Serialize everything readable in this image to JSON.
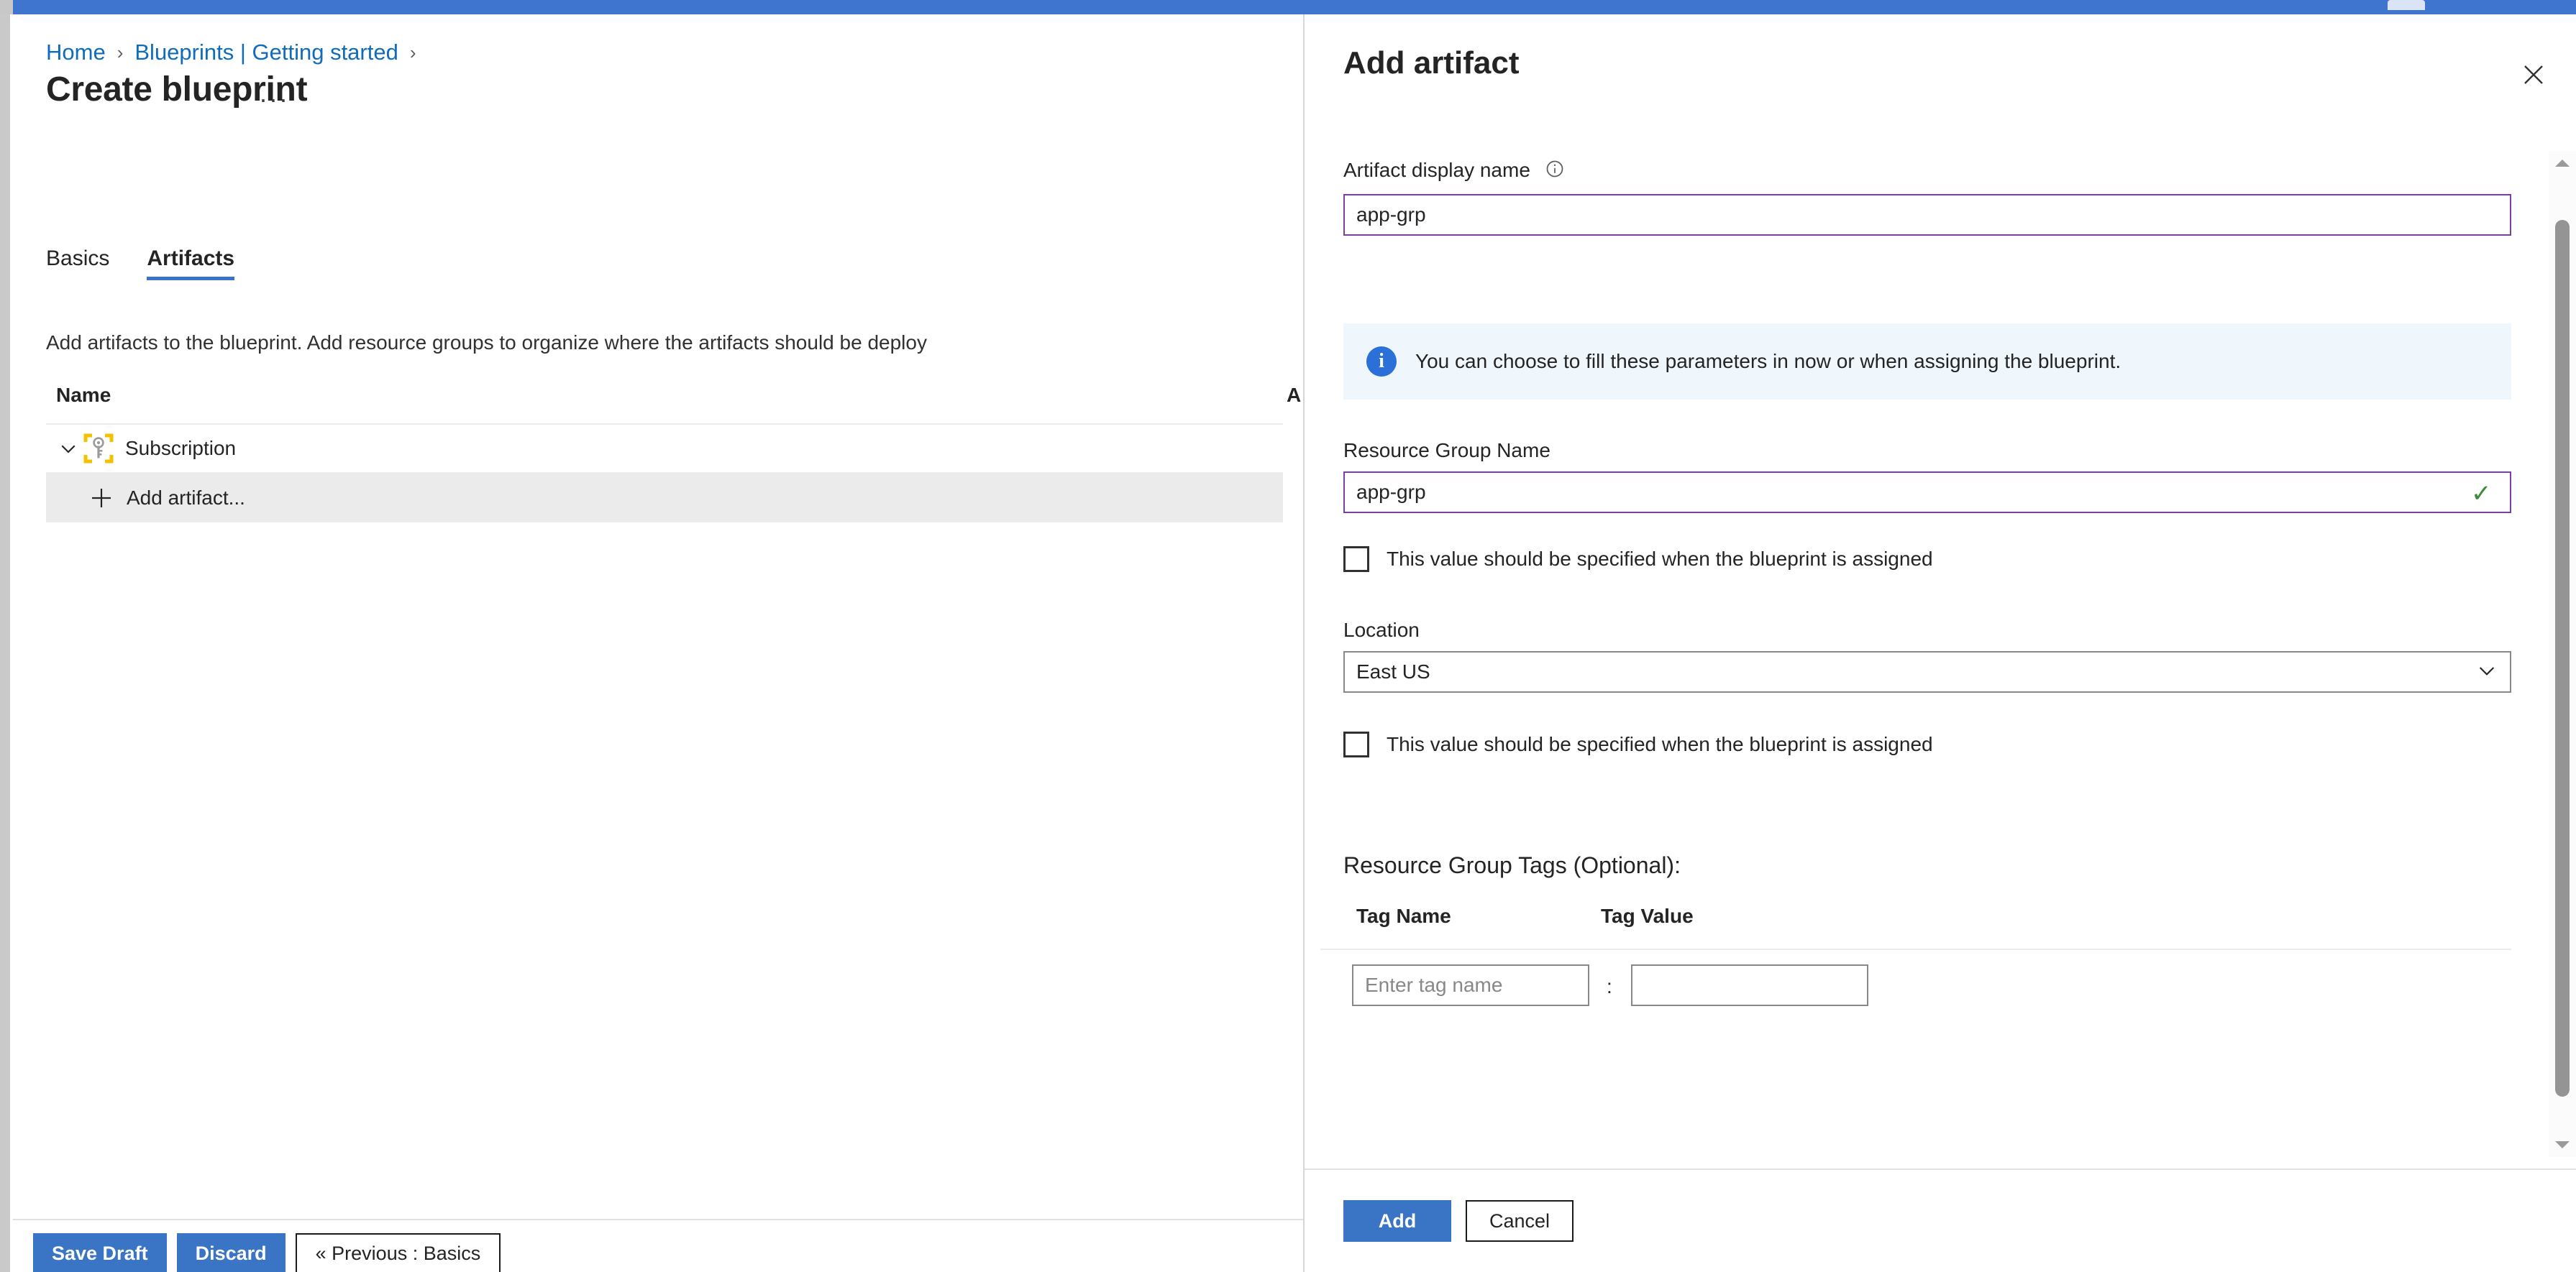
{
  "breadcrumb": {
    "items": [
      {
        "label": "Home"
      },
      {
        "label": "Blueprints | Getting started"
      }
    ],
    "separator": "›"
  },
  "page": {
    "title": "Create blueprint",
    "more_actions": "···"
  },
  "tabs": [
    {
      "label": "Basics",
      "active": false
    },
    {
      "label": "Artifacts",
      "active": true
    }
  ],
  "artifacts_section": {
    "description": "Add artifacts to the blueprint. Add resource groups to organize where the artifacts should be deploy",
    "columns": {
      "name": "Name",
      "artifact_type": "A"
    },
    "rows": [
      {
        "label": "Subscription",
        "icon": "subscription-key-icon",
        "expanded": true
      },
      {
        "label": "Add artifact...",
        "icon": "plus-icon",
        "highlighted": true
      }
    ]
  },
  "main_footer": {
    "save_draft": "Save Draft",
    "discard": "Discard",
    "previous": "« Previous : Basics"
  },
  "panel": {
    "title": "Add artifact",
    "close_label": "✕",
    "artifact_display_name": {
      "label": "Artifact display name",
      "value": "app-grp",
      "info_icon": "info-icon"
    },
    "info_banner": {
      "icon": "info-icon",
      "text": "You can choose to fill these parameters in now or when assigning the blueprint."
    },
    "resource_group_name": {
      "label": "Resource Group Name",
      "value": "app-grp",
      "valid": true,
      "valid_mark": "✓"
    },
    "assign_checkbox_1": {
      "label": "This value should be specified when the blueprint is assigned",
      "checked": false
    },
    "location": {
      "label": "Location",
      "value": "East US",
      "chevron": "chevron-down-icon"
    },
    "assign_checkbox_2": {
      "label": "This value should be specified when the blueprint is assigned",
      "checked": false
    },
    "tags": {
      "title": "Resource Group Tags (Optional):",
      "col_name": "Tag Name",
      "col_value": "Tag Value",
      "separator": ":",
      "rows": [
        {
          "name_value": "",
          "name_placeholder": "Enter tag name",
          "value_value": "",
          "value_placeholder": ""
        }
      ]
    },
    "footer": {
      "add": "Add",
      "cancel": "Cancel"
    }
  },
  "colors": {
    "accent_blue": "#3a74c4",
    "link_blue": "#0f6cbd",
    "focus_purple": "#7a3fa0",
    "valid_green": "#3a8a3a",
    "banner_bg": "#eff6fc",
    "row_highlight": "#ebebeb",
    "topbar_blue": "#3f75ce"
  }
}
